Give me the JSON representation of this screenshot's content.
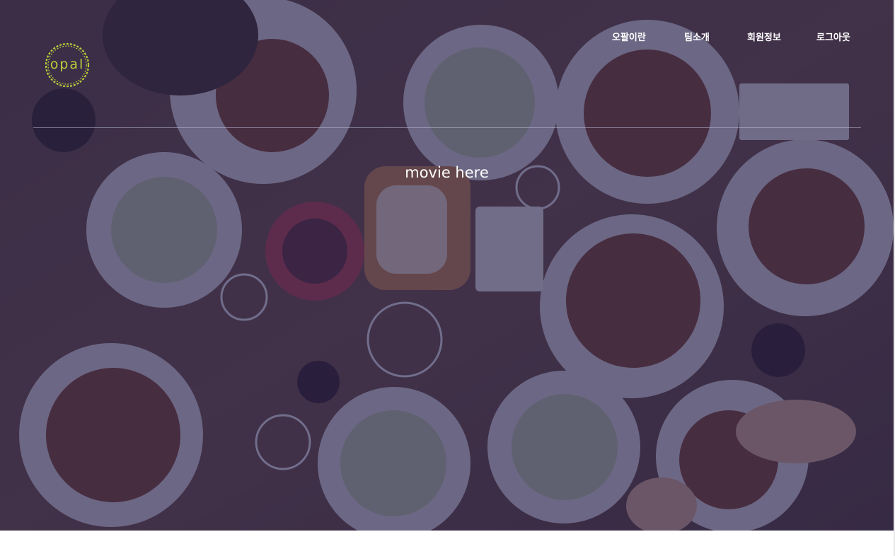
{
  "logo": {
    "text": "opal",
    "accent_color": "#b9cf3a"
  },
  "nav": {
    "items": [
      {
        "label": "오팔이란"
      },
      {
        "label": "팀소개"
      },
      {
        "label": "회원정보"
      },
      {
        "label": "로그아웃"
      }
    ]
  },
  "hero": {
    "placeholder_text": "movie here",
    "overlay_color": "#282450",
    "image_subject": "overhead-dinner-table-photo"
  }
}
